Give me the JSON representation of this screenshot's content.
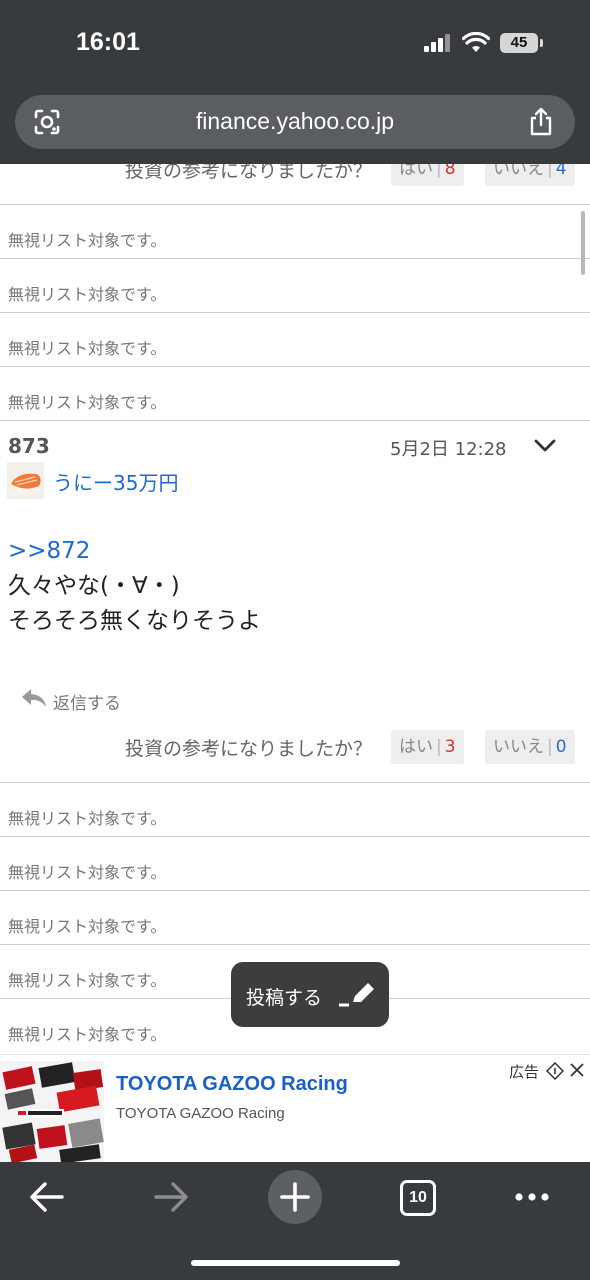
{
  "status_bar": {
    "time": "16:01",
    "battery": "45"
  },
  "browser": {
    "url": "finance.yahoo.co.jp",
    "tab_count": "10"
  },
  "vote": {
    "question": "投資の参考になりましたか？",
    "yes_label": "はい",
    "no_label": "いいえ",
    "colors": {
      "yes": "#d1332c",
      "no": "#2b6bd6"
    }
  },
  "top_vote": {
    "yes_count": "8",
    "no_count": "4"
  },
  "ignored_text": "無視リスト対象です。",
  "post": {
    "number": "873",
    "date": "5月2日 12:28",
    "user": "うにー35万円",
    "anchor": ">>872",
    "lines": [
      "久々やな(・∀・)",
      "そろそろ無くなりそうよ"
    ],
    "reply_label": "返信する",
    "yes_count": "3",
    "no_count": "0"
  },
  "fab": {
    "label": "投稿する"
  },
  "ad": {
    "title": "TOYOTA GAZOO Racing",
    "subtitle": "TOYOTA GAZOO Racing",
    "label": "広告"
  }
}
